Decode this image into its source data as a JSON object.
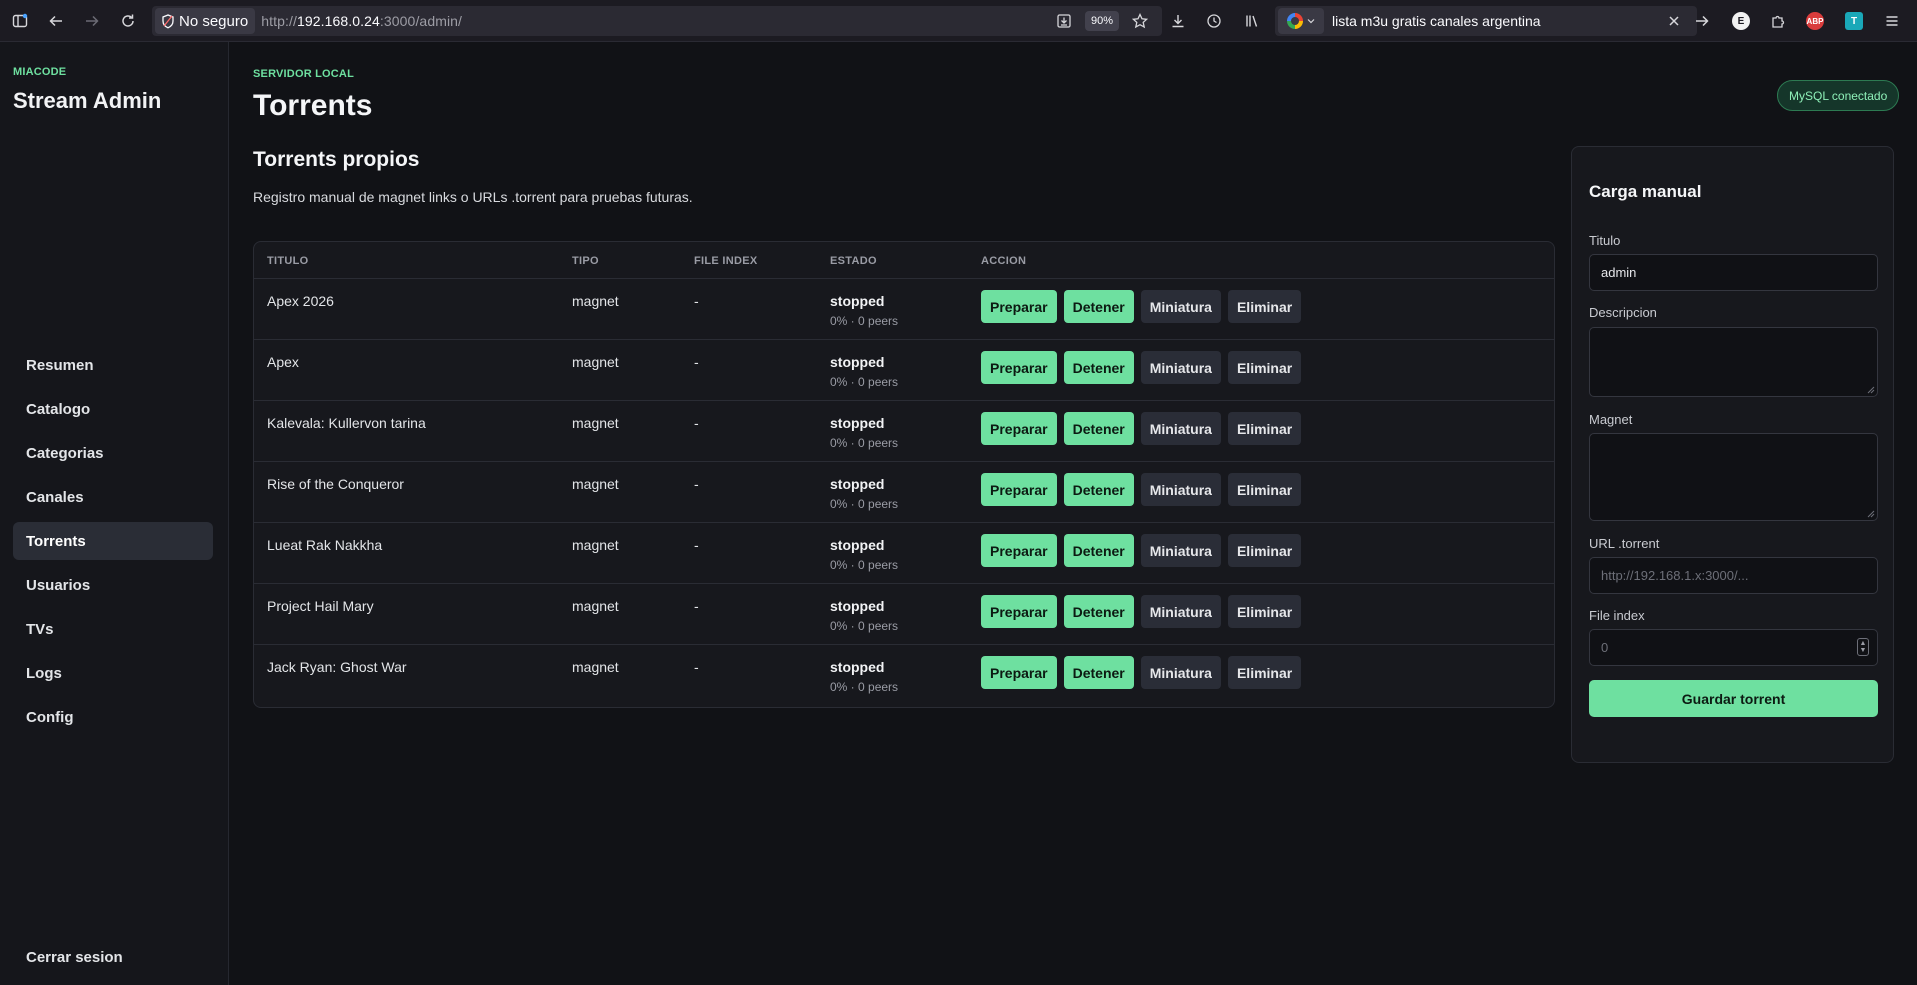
{
  "browser": {
    "security_label": "No seguro",
    "url_prefix": "http://",
    "url_host": "192.168.0.24",
    "url_rest": ":3000/admin/",
    "zoom": "90%",
    "search_text": "lista m3u gratis canales argentina",
    "ext_e": "E",
    "ext_abp": "ABP",
    "ext_t": "T"
  },
  "sidebar": {
    "brand_small": "MIACODE",
    "brand": "Stream Admin",
    "items": [
      {
        "label": "Resumen",
        "active": false
      },
      {
        "label": "Catalogo",
        "active": false
      },
      {
        "label": "Categorias",
        "active": false
      },
      {
        "label": "Canales",
        "active": false
      },
      {
        "label": "Torrents",
        "active": true
      },
      {
        "label": "Usuarios",
        "active": false
      },
      {
        "label": "TVs",
        "active": false
      },
      {
        "label": "Logs",
        "active": false
      },
      {
        "label": "Config",
        "active": false
      }
    ],
    "logout": "Cerrar sesion"
  },
  "header": {
    "eyebrow": "SERVIDOR LOCAL",
    "title": "Torrents",
    "status": "MySQL conectado"
  },
  "section": {
    "title": "Torrents propios",
    "description": "Registro manual de magnet links o URLs .torrent para pruebas futuras."
  },
  "table": {
    "columns": [
      "TITULO",
      "TIPO",
      "FILE INDEX",
      "ESTADO",
      "ACCION"
    ],
    "actions": [
      "Preparar",
      "Detener",
      "Miniatura",
      "Eliminar"
    ],
    "rows": [
      {
        "title": "Apex 2026",
        "type": "magnet",
        "file_index": "-",
        "state": "stopped",
        "detail": "0% · 0 peers"
      },
      {
        "title": "Apex",
        "type": "magnet",
        "file_index": "-",
        "state": "stopped",
        "detail": "0% · 0 peers"
      },
      {
        "title": "Kalevala: Kullervon tarina",
        "type": "magnet",
        "file_index": "-",
        "state": "stopped",
        "detail": "0% · 0 peers"
      },
      {
        "title": "Rise of the Conqueror",
        "type": "magnet",
        "file_index": "-",
        "state": "stopped",
        "detail": "0% · 0 peers"
      },
      {
        "title": "Lueat Rak Nakkha",
        "type": "magnet",
        "file_index": "-",
        "state": "stopped",
        "detail": "0% · 0 peers"
      },
      {
        "title": "Project Hail Mary",
        "type": "magnet",
        "file_index": "-",
        "state": "stopped",
        "detail": "0% · 0 peers"
      },
      {
        "title": "Jack Ryan: Ghost War",
        "type": "magnet",
        "file_index": "-",
        "state": "stopped",
        "detail": "0% · 0 peers"
      }
    ]
  },
  "form": {
    "title": "Carga manual",
    "titulo_label": "Titulo",
    "titulo_value": "admin",
    "descripcion_label": "Descripcion",
    "descripcion_value": "",
    "magnet_label": "Magnet",
    "magnet_value": "",
    "url_label": "URL .torrent",
    "url_placeholder": "http://192.168.1.x:3000/...",
    "file_index_label": "File index",
    "file_index_placeholder": "0",
    "submit": "Guardar torrent"
  }
}
